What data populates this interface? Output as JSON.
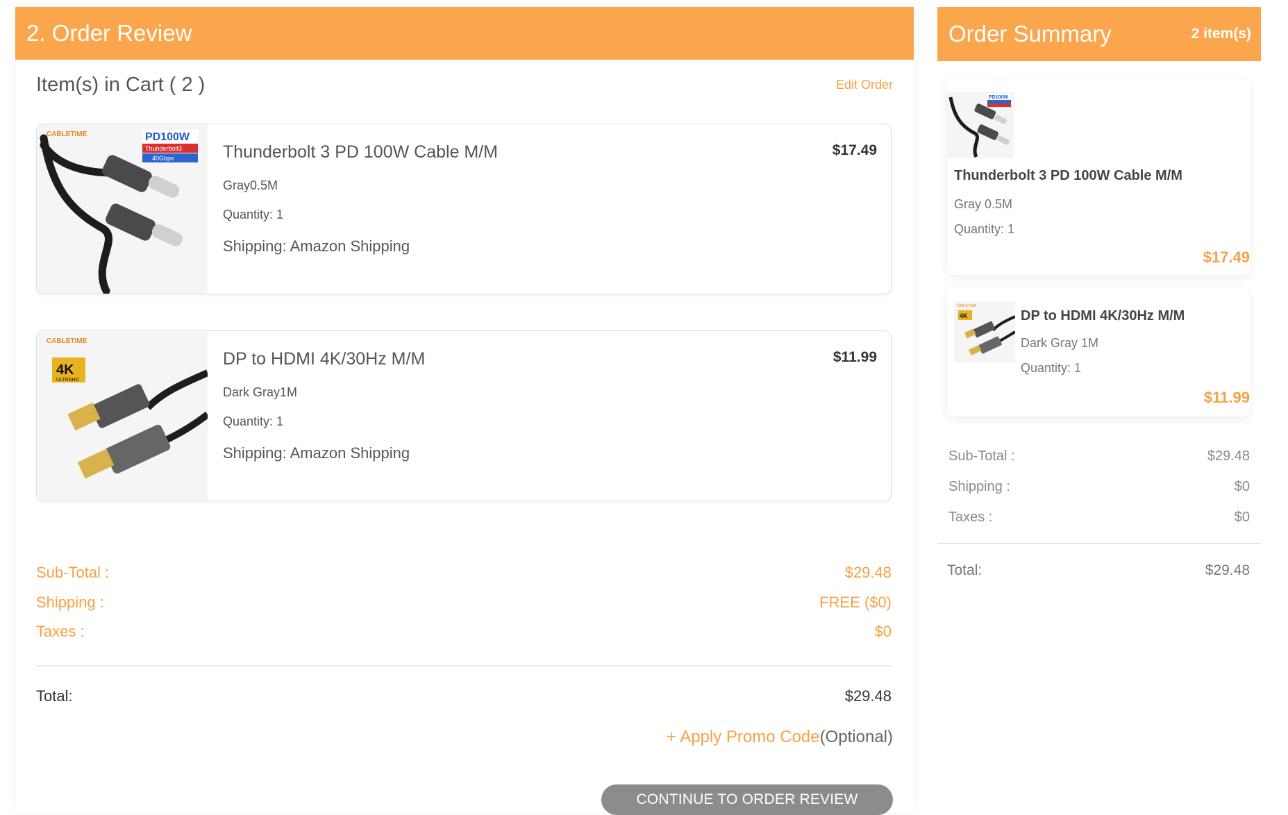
{
  "review": {
    "header_title": "2. Order Review",
    "cart_title": "Item(s) in Cart ( 2 )",
    "edit_order_label": "Edit Order",
    "items": [
      {
        "name": "Thunderbolt 3 PD 100W Cable M/M",
        "price": "$17.49",
        "variant": "Gray0.5M",
        "quantity": "Quantity: 1",
        "shipping": "Shipping: Amazon Shipping",
        "thumb_brand": "CABLETIME",
        "thumb_badge_main": "PD100W",
        "thumb_badge_sub1": "Thunderbolt3",
        "thumb_badge_sub2": "40Gbps"
      },
      {
        "name": "DP to HDMI 4K/30Hz M/M",
        "price": "$11.99",
        "variant": "Dark Gray1M",
        "quantity": "Quantity: 1",
        "shipping": "Shipping: Amazon Shipping",
        "thumb_brand": "CABLETIME",
        "thumb_badge_main": "4K",
        "thumb_badge_sub1": "ULTRAHD"
      }
    ],
    "totals": {
      "subtotal_label": "Sub-Total :",
      "subtotal_value": "$29.48",
      "shipping_label": "Shipping :",
      "shipping_value": "FREE ($0)",
      "taxes_label": "Taxes :",
      "taxes_value": "$0",
      "total_label": "Total:",
      "total_value": "$29.48"
    },
    "promo_link": "+ Apply Promo Code",
    "promo_optional": "(Optional)",
    "continue_button": "CONTINUE TO ORDER REVIEW"
  },
  "summary": {
    "title": "Order Summary",
    "count": "2 item(s)",
    "items": [
      {
        "name": "Thunderbolt 3 PD 100W Cable M/M",
        "variant": "Gray 0.5M",
        "quantity_label": "Quantity: ",
        "quantity_value": "1",
        "price": "$17.49",
        "thumb_badge_main": "PD100W",
        "thumb_badge_sub1": "Thunderbolt3",
        "thumb_badge_sub2": "40Gbps"
      },
      {
        "name": "DP to HDMI 4K/30Hz M/M",
        "variant": "Dark Gray 1M",
        "quantity_label": "Quantity: ",
        "quantity_value": "1",
        "price": "$11.99",
        "thumb_brand": "CABLETIME",
        "thumb_badge_main": "4K"
      }
    ],
    "subtotal_label": "Sub-Total :",
    "subtotal_value": "$29.48",
    "shipping_label": "Shipping :",
    "shipping_value": "$0",
    "taxes_label": "Taxes :",
    "taxes_value": "$0",
    "total_label": "Total:",
    "total_value": "$29.48"
  },
  "colors": {
    "accent": "#fba54d",
    "accent_text": "#f7a145",
    "button": "#8c8c8c"
  }
}
